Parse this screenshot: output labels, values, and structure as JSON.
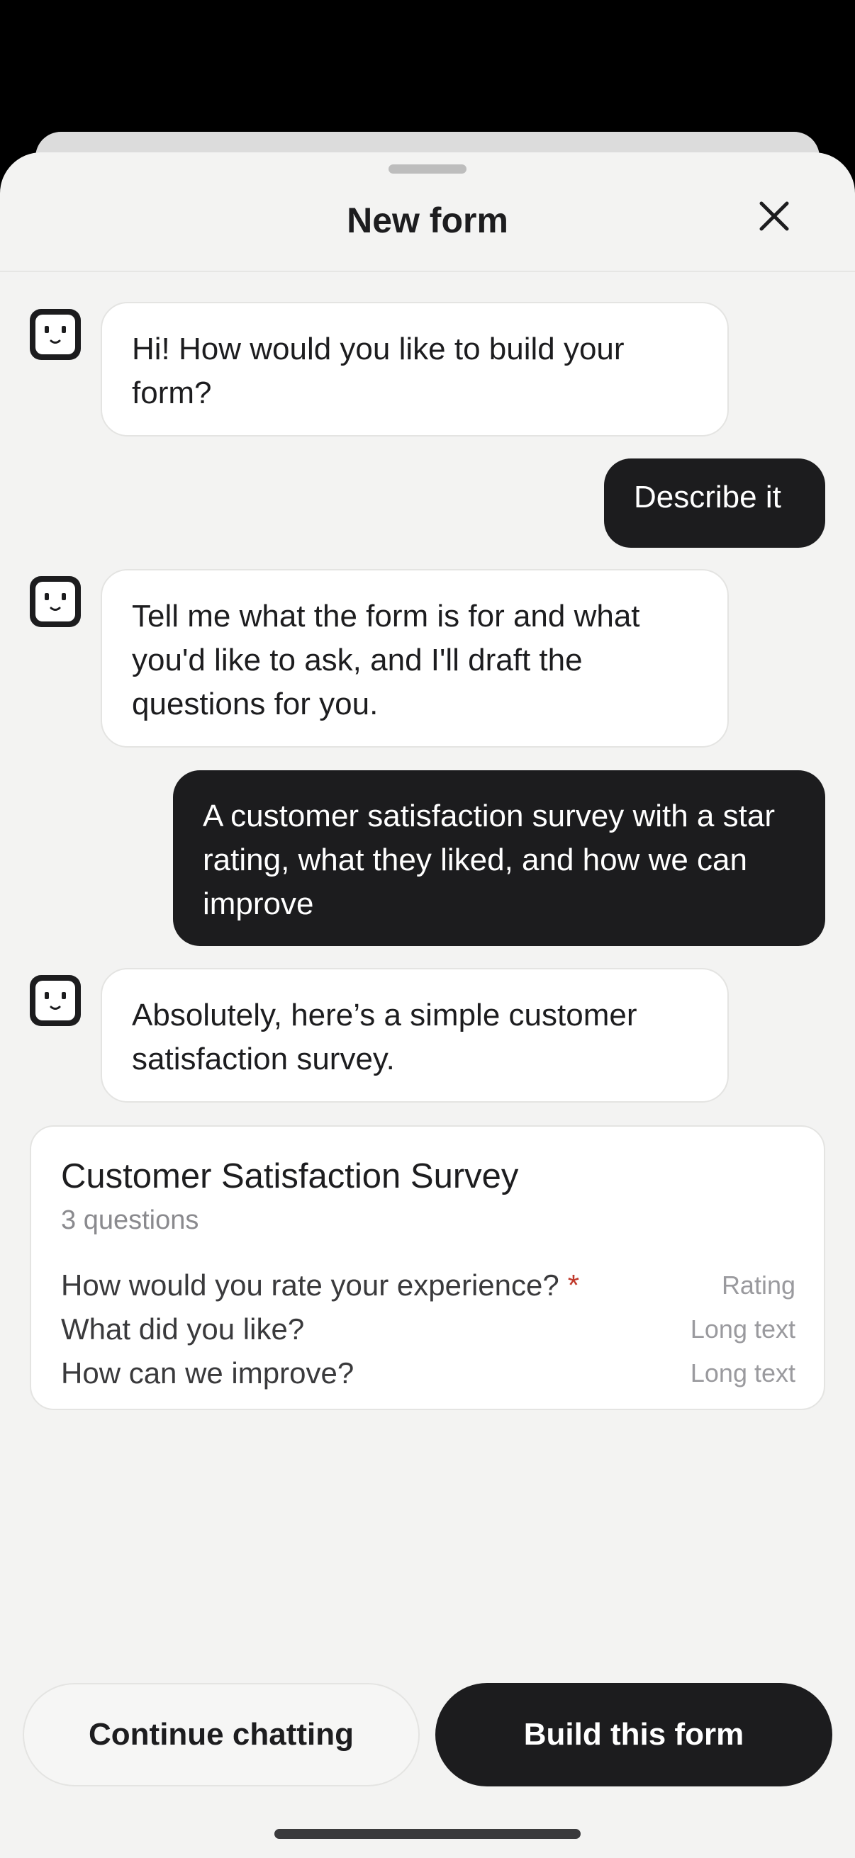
{
  "header": {
    "title": "New form",
    "close_icon": "close-icon"
  },
  "messages": [
    {
      "role": "assistant",
      "text": "Hi! How would you like to build your form?"
    },
    {
      "role": "user",
      "text": "Describe it"
    },
    {
      "role": "assistant",
      "text": "Tell me what the form is for and what you'd like to ask, and I'll draft the questions for you."
    },
    {
      "role": "user",
      "text": "A customer satisfaction survey with a star rating, what they liked, and how we can improve"
    },
    {
      "role": "assistant",
      "text": "Absolutely, here’s a simple customer satisfaction survey."
    }
  ],
  "form_preview": {
    "title": "Customer Satisfaction Survey",
    "subtitle": "3 questions",
    "questions": [
      {
        "text": "How would you rate your experience?",
        "required_mark": "*",
        "type": "Rating"
      },
      {
        "text": "What did you like?",
        "required_mark": "",
        "type": "Long text"
      },
      {
        "text": "How can we improve?",
        "required_mark": "",
        "type": "Long text"
      }
    ]
  },
  "actions": {
    "continue_label": "Continue chatting",
    "build_label": "Build this form"
  },
  "colors": {
    "sheet_background": "#f3f3f2",
    "user_bubble": "#1c1c1e",
    "required": "#c0392b"
  }
}
